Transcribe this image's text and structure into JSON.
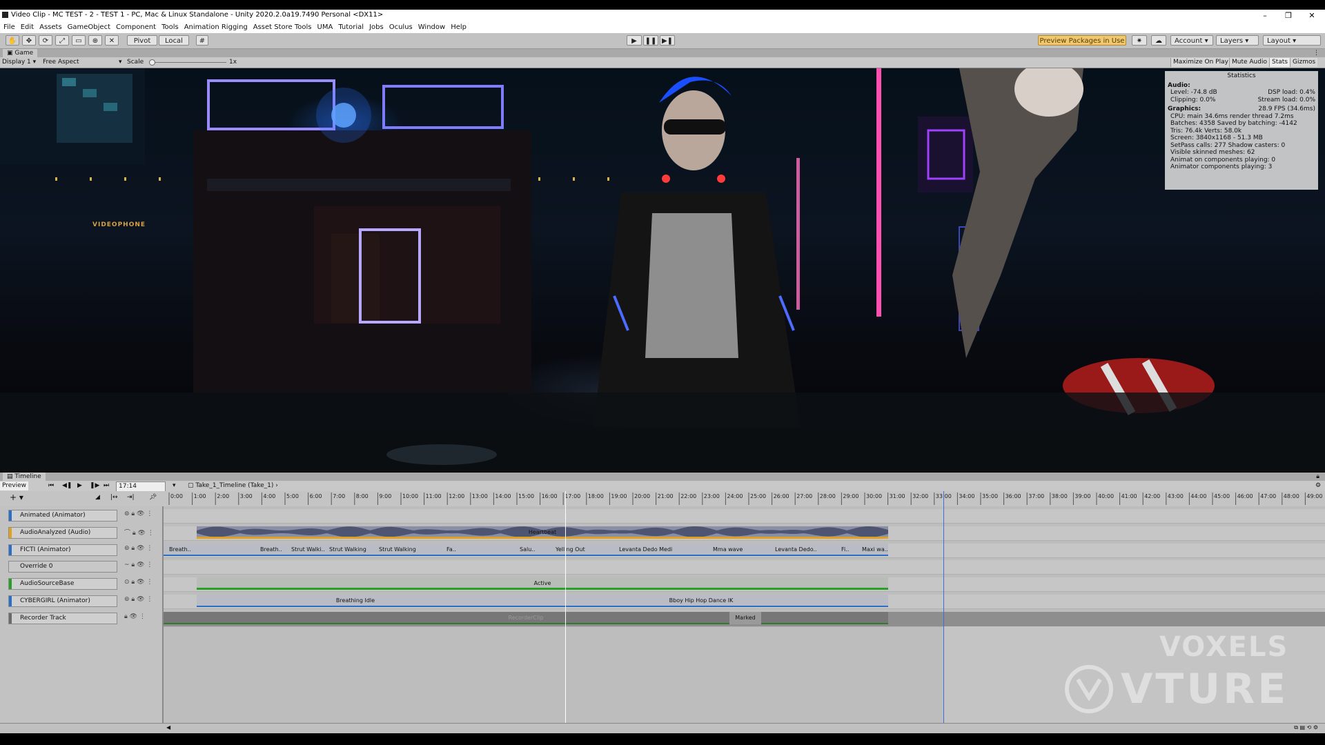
{
  "window": {
    "title": "Video Clip - MC TEST - 2 - TEST 1 - PC, Mac & Linux Standalone - Unity 2020.2.0a19.7490 Personal <DX11>",
    "min": "–",
    "max": "❐",
    "close": "✕"
  },
  "menu": [
    "File",
    "Edit",
    "Assets",
    "GameObject",
    "Component",
    "Tools",
    "Animation Rigging",
    "Asset Store Tools",
    "UMA",
    "Tutorial",
    "Jobs",
    "Oculus",
    "Window",
    "Help"
  ],
  "toolbar": {
    "pivot": "Pivot",
    "local": "Local",
    "play_icon": "play-icon",
    "pause_icon": "pause-icon",
    "step_icon": "step-icon",
    "preview_packages": "Preview Packages in Use ▾",
    "account": "Account",
    "layers": "Layers",
    "layout": "Layout"
  },
  "game": {
    "tab": "Game",
    "display": "Display 1",
    "aspect": "Free Aspect",
    "scale_label": "Scale",
    "scale_value": "1x",
    "maximize": "Maximize On Play",
    "mute": "Mute Audio",
    "stats": "Stats",
    "gizmos": "Gizmos",
    "sign_text": "VIDEOPHONE"
  },
  "stats": {
    "title": "Statistics",
    "audio_header": "Audio:",
    "level": "Level: -74.8 dB",
    "dsp": "DSP load: 0.4%",
    "clipping": "Clipping: 0.0%",
    "stream": "Stream load: 0.0%",
    "graphics_header": "Graphics:",
    "fps": "28.9 FPS (34.6ms)",
    "cpu": "CPU: main 34.6ms  render thread 7.2ms",
    "batches": "Batches: 4358  Saved by batching: -4142",
    "tris": "Tris: 76.4k    Verts: 58.0k",
    "screen": "Screen: 3840x1168 - 51.3 MB",
    "setpass": "SetPass calls: 277     Shadow casters: 0",
    "skinned": "Visible skinned meshes: 62",
    "animations": "Animat on components playing: 0",
    "animators": "Animator components playing: 3"
  },
  "timeline": {
    "tab": "Timeline",
    "preview": "Preview",
    "time": "17:14",
    "asset": "Take_1_Timeline (Take_1)",
    "ticks": [
      "0:00",
      "1:00",
      "2:00",
      "3:00",
      "4:00",
      "5:00",
      "6:00",
      "7:00",
      "8:00",
      "9:00",
      "10:00",
      "11:00",
      "12:00",
      "13:00",
      "14:00",
      "15:00",
      "16:00",
      "17:00",
      "18:00",
      "19:00",
      "20:00",
      "21:00",
      "22:00",
      "23:00",
      "24:00",
      "25:00",
      "26:00",
      "27:00",
      "28:00",
      "29:00",
      "30:00",
      "31:00",
      "32:00",
      "33:00",
      "34:00",
      "35:00",
      "36:00",
      "37:00",
      "38:00",
      "39:00",
      "40:00",
      "41:00",
      "42:00",
      "43:00",
      "44:00",
      "45:00",
      "46:00",
      "47:00",
      "48:00",
      "49:00"
    ],
    "tracks": [
      {
        "label": "Animated (Animator)",
        "color": "#2a6ec8"
      },
      {
        "label": "AudioAnalyzed (Audio)",
        "color": "#e0a020"
      },
      {
        "label": "FICTI (Animator)",
        "color": "#2a6ec8"
      },
      {
        "label": "Override 0",
        "color": "#2a6ec8"
      },
      {
        "label": "AudioSourceBase",
        "color": "#28a028"
      },
      {
        "label": "CYBERGIRL (Animator)",
        "color": "#2a6ec8"
      },
      {
        "label": "Recorder Track",
        "color": "#6a6a6a"
      }
    ],
    "audio_clip": "Heartbeat",
    "ficti_clips": [
      "Breath..",
      "Breath..",
      "Strut Walki..",
      "Strut Walking",
      "Strut Walking",
      "Fa..",
      "Salu..",
      "Yelling Out",
      "Levanta Dedo Medi",
      "Mma wave",
      "Levanta Dedo..",
      "Fi..",
      "Maxi wa.."
    ],
    "activation": "Active",
    "cyber_clips": [
      "Breathing Idle",
      "Bboy Hip Hop Dance IK"
    ],
    "recorder_clips": [
      "RecorderClip",
      "Marked"
    ]
  },
  "watermark": {
    "line1": "VOXELS",
    "line2": "VTURE"
  }
}
